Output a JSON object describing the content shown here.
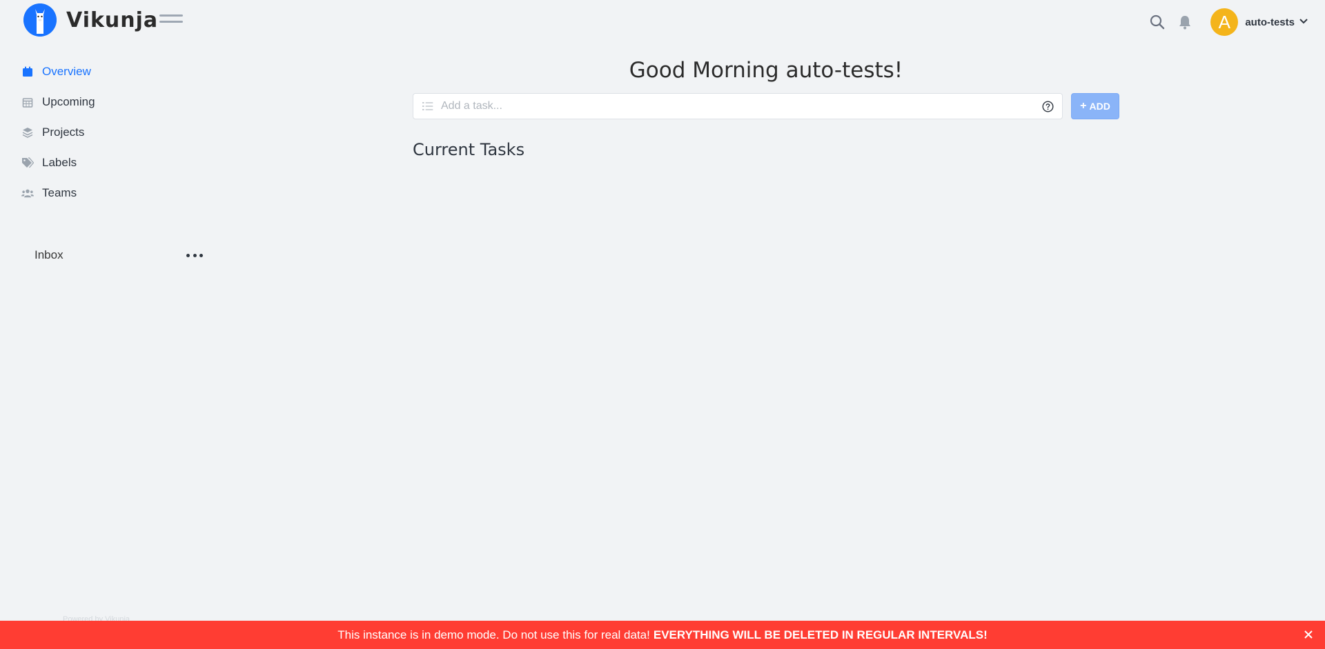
{
  "app": {
    "name": "Vikunja",
    "logo_icon": "llama-logo-icon"
  },
  "header": {
    "menu_icon": "hamburger-menu-icon",
    "search_icon": "search-icon",
    "notifications_icon": "bell-icon",
    "user": {
      "avatar_letter": "A",
      "name": "auto-tests",
      "avatar_color": "#f4b41a"
    }
  },
  "sidebar": {
    "items": [
      {
        "label": "Overview",
        "icon": "calendar-icon",
        "active": true
      },
      {
        "label": "Upcoming",
        "icon": "calendar-grid-icon",
        "active": false
      },
      {
        "label": "Projects",
        "icon": "layers-icon",
        "active": false
      },
      {
        "label": "Labels",
        "icon": "tags-icon",
        "active": false
      },
      {
        "label": "Teams",
        "icon": "users-icon",
        "active": false
      }
    ],
    "projects": [
      {
        "label": "Inbox",
        "menu_icon": "more-dots-icon"
      }
    ],
    "powered_by": "Powered by Vikunja"
  },
  "main": {
    "greeting": "Good Morning auto-tests!",
    "add_task": {
      "placeholder": "Add a task...",
      "value": "",
      "button_label": "ADD",
      "button_icon": "plus-icon",
      "help_icon": "question-circle-icon"
    },
    "current_tasks_title": "Current Tasks"
  },
  "demo_banner": {
    "text": "This instance is in demo mode. Do not use this for real data!",
    "emphasis": "EVERYTHING WILL BE DELETED IN REGULAR INTERVALS!",
    "close_icon": "close-icon",
    "color": "#ff3d33"
  },
  "colors": {
    "accent": "#1973ff",
    "background": "#f1f3f5"
  }
}
